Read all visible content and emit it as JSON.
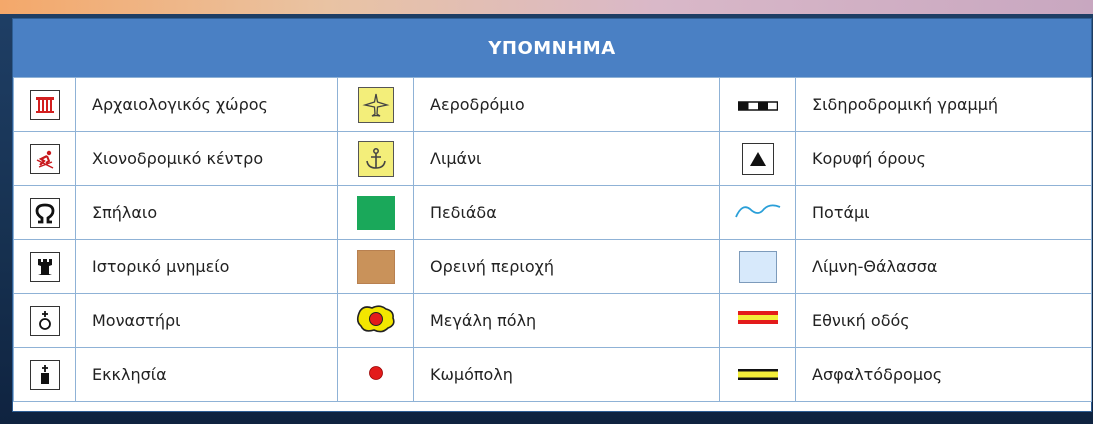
{
  "legend": {
    "title": "ΥΠΟΜΝΗΜΑ",
    "rows": [
      [
        {
          "icon": "temple-icon",
          "label": "Αρχαιολογικός χώρος"
        },
        {
          "icon": "airport-icon",
          "label": "Αεροδρόμιο"
        },
        {
          "icon": "railway-icon",
          "label": "Σιδηροδρομική γραμμή"
        }
      ],
      [
        {
          "icon": "ski-icon",
          "label": "Χιονοδρομικό κέντρο"
        },
        {
          "icon": "anchor-icon",
          "label": "Λιμάνι"
        },
        {
          "icon": "mountain-peak-icon",
          "label": "Κορυφή όρους"
        }
      ],
      [
        {
          "icon": "cave-icon",
          "label": "Σπήλαιο"
        },
        {
          "icon": "plain-swatch-icon",
          "label": "Πεδιάδα"
        },
        {
          "icon": "river-icon",
          "label": "Ποτάμι"
        }
      ],
      [
        {
          "icon": "tower-icon",
          "label": "Ιστορικό μνημείο"
        },
        {
          "icon": "mountain-area-swatch-icon",
          "label": "Ορεινή περιοχή"
        },
        {
          "icon": "lake-swatch-icon",
          "label": "Λίμνη-Θάλασσα"
        }
      ],
      [
        {
          "icon": "monastery-icon",
          "label": "Μοναστήρι"
        },
        {
          "icon": "big-city-icon",
          "label": "Μεγάλη πόλη"
        },
        {
          "icon": "national-road-icon",
          "label": "Εθνική οδός"
        }
      ],
      [
        {
          "icon": "church-icon",
          "label": "Εκκλησία"
        },
        {
          "icon": "town-dot-icon",
          "label": "Κωμόπολη"
        },
        {
          "icon": "paved-road-icon",
          "label": "Ασφαλτόδρομος"
        }
      ]
    ]
  },
  "colors": {
    "header": "#4a80c4",
    "plain": "#1aa85a",
    "mountain_area": "#c9925a",
    "lake": "#d7e9fb",
    "river": "#2a9fd8",
    "red": "#e31b1b",
    "yellow": "#f3ee3a"
  }
}
